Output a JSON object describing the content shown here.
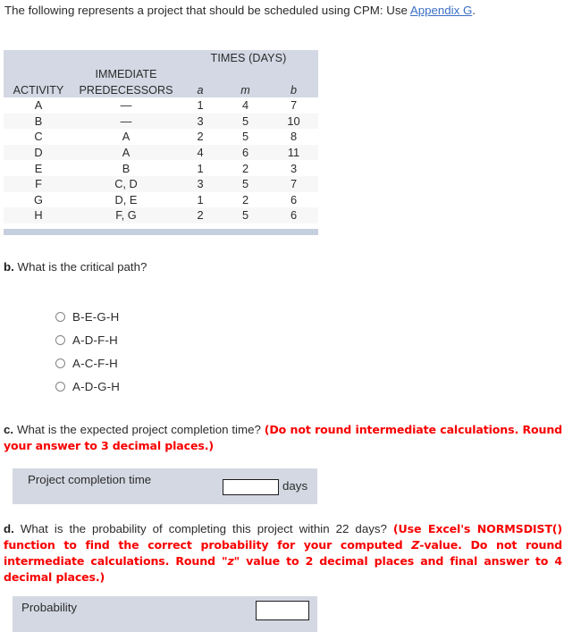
{
  "intro": {
    "text_before": "The following represents a project that should be scheduled using CPM: Use ",
    "link_text": "Appendix G",
    "text_after": "."
  },
  "table": {
    "group_header_times": "TIMES (DAYS)",
    "header_immediate": "IMMEDIATE",
    "header_activity": "ACTIVITY",
    "header_predecessors": "PREDECESSORS",
    "header_a": "a",
    "header_m": "m",
    "header_b": "b",
    "rows": [
      {
        "activity": "A",
        "predecessors": "—",
        "a": "1",
        "m": "4",
        "b": "7"
      },
      {
        "activity": "B",
        "predecessors": "—",
        "a": "3",
        "m": "5",
        "b": "10"
      },
      {
        "activity": "C",
        "predecessors": "A",
        "a": "2",
        "m": "5",
        "b": "8"
      },
      {
        "activity": "D",
        "predecessors": "A",
        "a": "4",
        "m": "6",
        "b": "11"
      },
      {
        "activity": "E",
        "predecessors": "B",
        "a": "1",
        "m": "2",
        "b": "3"
      },
      {
        "activity": "F",
        "predecessors": "C, D",
        "a": "3",
        "m": "5",
        "b": "7"
      },
      {
        "activity": "G",
        "predecessors": "D, E",
        "a": "1",
        "m": "2",
        "b": "6"
      },
      {
        "activity": "H",
        "predecessors": "F, G",
        "a": "2",
        "m": "5",
        "b": "6"
      }
    ]
  },
  "part_b": {
    "label": "b.",
    "question": "What is the critical path?",
    "options": [
      {
        "label": "B-E-G-H",
        "selected": false
      },
      {
        "label": "A-D-F-H",
        "selected": false
      },
      {
        "label": "A-C-F-H",
        "selected": false
      },
      {
        "label": "A-D-G-H",
        "selected": false
      }
    ]
  },
  "part_c": {
    "label": "c.",
    "question": "What is the expected project completion time?",
    "instruction": "(Do not round intermediate calculations. Round your answer to 3 decimal places.)",
    "answer_label": "Project completion time",
    "answer_value": "",
    "unit": "days"
  },
  "part_d": {
    "label": "d.",
    "question": "What is the probability of completing this project within 22 days?",
    "instruction_part1": "(Use Excel's NORMSDIST() function to find the correct probability for your computed ",
    "instruction_italic1": "Z",
    "instruction_part2": "-value. Do not round intermediate calculations. Round \"",
    "instruction_italic2": "z",
    "instruction_part3": "\" value to 2 decimal places and final answer to 4 decimal places.)",
    "answer_label": "Probability",
    "answer_value": ""
  },
  "colors": {
    "header_bg": "#d3d8e4",
    "footer_bar": "#c6cfdf",
    "alt_row": "#f7f7f7",
    "panel_bg": "#d4d8e3",
    "instruction_red": "#f80000",
    "link_blue": "#3b6fc4"
  }
}
